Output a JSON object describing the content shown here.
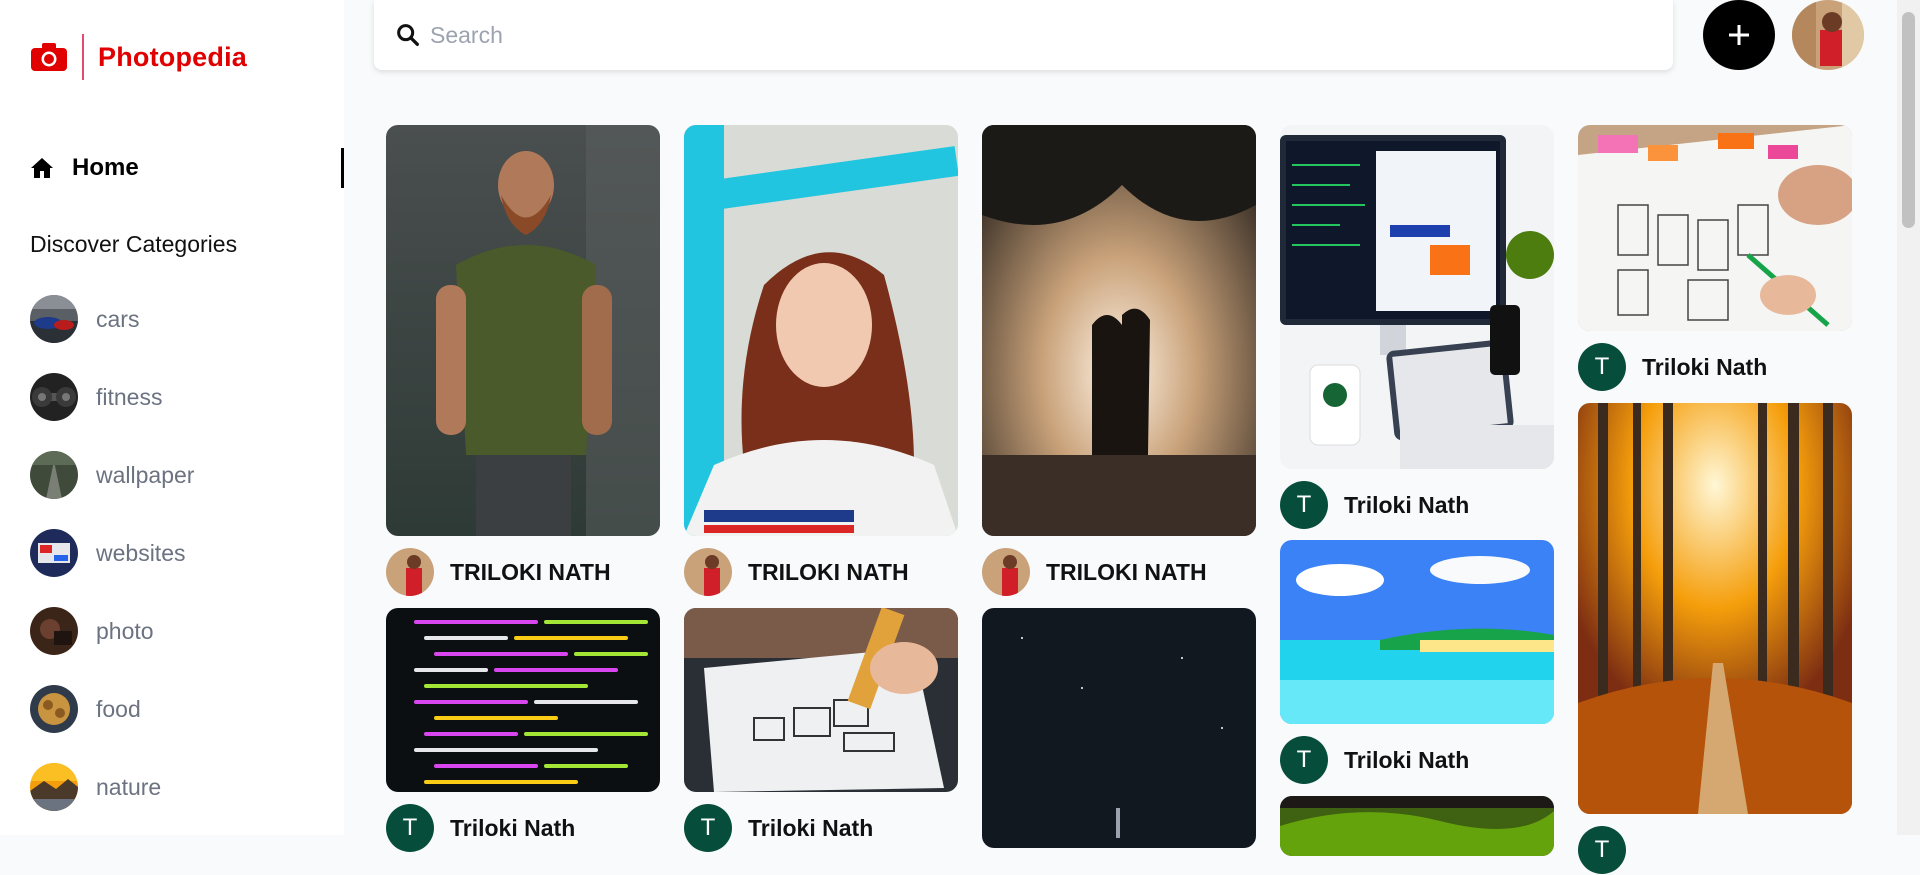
{
  "app": {
    "name": "Photopedia",
    "brand_color": "#e00000"
  },
  "nav": {
    "home_label": "Home",
    "discover_heading": "Discover Categories"
  },
  "categories": [
    {
      "label": "cars"
    },
    {
      "label": "fitness"
    },
    {
      "label": "wallpaper"
    },
    {
      "label": "websites"
    },
    {
      "label": "photo"
    },
    {
      "label": "food"
    },
    {
      "label": "nature"
    }
  ],
  "search": {
    "placeholder": "Search",
    "value": ""
  },
  "toolbar": {
    "add_icon": "plus-icon",
    "profile_avatar": "user-avatar"
  },
  "pins": [
    {
      "user_name": "TRILOKI NATH",
      "avatar": "photo",
      "image": "bearded man in green shirt"
    },
    {
      "user_name": "TRILOKI NATH",
      "avatar": "photo",
      "image": "red-haired woman"
    },
    {
      "user_name": "TRILOKI NATH",
      "avatar": "photo",
      "image": "couple silhouette in fog"
    },
    {
      "user_name": "Triloki Nath",
      "avatar_letter": "T",
      "image": "computer and tablet on desk"
    },
    {
      "user_name": "Triloki Nath",
      "avatar_letter": "T",
      "image": "wireframe sketches"
    },
    {
      "user_name": "Triloki Nath",
      "avatar_letter": "T",
      "image": "code on screen"
    },
    {
      "user_name": "Triloki Nath",
      "avatar_letter": "T",
      "image": "hand sketching wireframe"
    },
    {
      "user_name": "",
      "image": "night sky with moon"
    },
    {
      "user_name": "Triloki Nath",
      "avatar_letter": "T",
      "image": "tropical beach"
    },
    {
      "user_name": "",
      "image": "green hills"
    },
    {
      "user_name": "",
      "image": "autumn forest path"
    }
  ]
}
